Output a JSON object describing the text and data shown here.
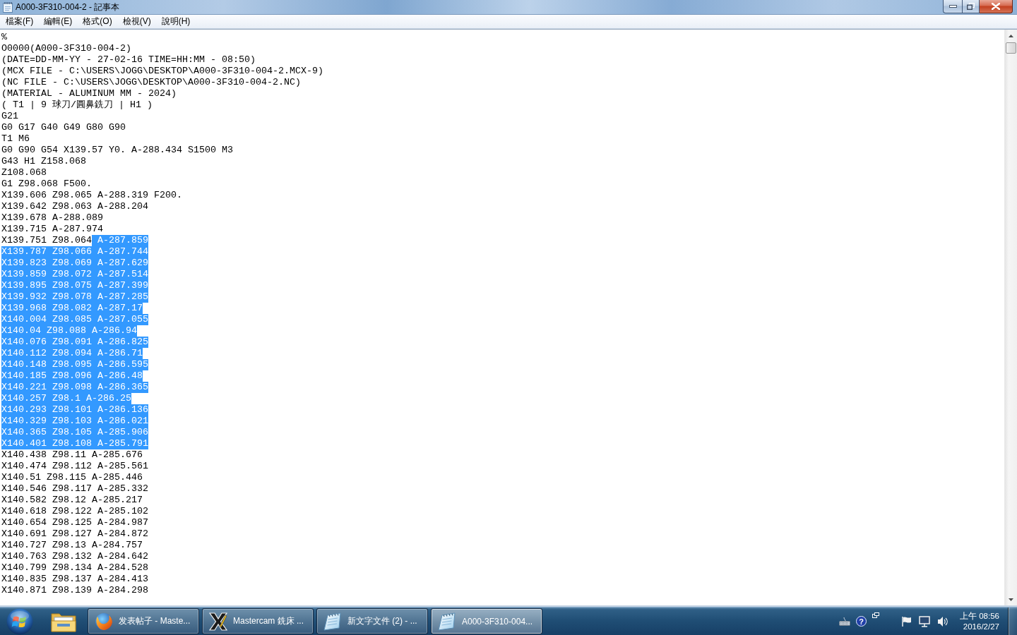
{
  "window": {
    "title": "A000-3F310-004-2 - 記事本"
  },
  "menu_bar": [
    "檔案(F)",
    "編輯(E)",
    "格式(O)",
    "檢視(V)",
    "說明(H)"
  ],
  "editor": {
    "lines": [
      {
        "segments": [
          {
            "text": "%",
            "selected": false
          }
        ]
      },
      {
        "segments": [
          {
            "text": "O0000(A000-3F310-004-2)",
            "selected": false
          }
        ]
      },
      {
        "segments": [
          {
            "text": "(DATE=DD-MM-YY - 27-02-16 TIME=HH:MM - 08:50)",
            "selected": false
          }
        ]
      },
      {
        "segments": [
          {
            "text": "(MCX FILE - C:\\USERS\\JOGG\\DESKTOP\\A000-3F310-004-2.MCX-9)",
            "selected": false
          }
        ]
      },
      {
        "segments": [
          {
            "text": "(NC FILE - C:\\USERS\\JOGG\\DESKTOP\\A000-3F310-004-2.NC)",
            "selected": false
          }
        ]
      },
      {
        "segments": [
          {
            "text": "(MATERIAL - ALUMINUM MM - 2024)",
            "selected": false
          }
        ]
      },
      {
        "segments": [
          {
            "text": "( T1 | 9 球刀/圓鼻銑刀 | H1 )",
            "selected": false
          }
        ]
      },
      {
        "segments": [
          {
            "text": "G21",
            "selected": false
          }
        ]
      },
      {
        "segments": [
          {
            "text": "G0 G17 G40 G49 G80 G90",
            "selected": false
          }
        ]
      },
      {
        "segments": [
          {
            "text": "T1 M6",
            "selected": false
          }
        ]
      },
      {
        "segments": [
          {
            "text": "G0 G90 G54 X139.57 Y0. A-288.434 S1500 M3",
            "selected": false
          }
        ]
      },
      {
        "segments": [
          {
            "text": "G43 H1 Z158.068",
            "selected": false
          }
        ]
      },
      {
        "segments": [
          {
            "text": "Z108.068",
            "selected": false
          }
        ]
      },
      {
        "segments": [
          {
            "text": "G1 Z98.068 F500.",
            "selected": false
          }
        ]
      },
      {
        "segments": [
          {
            "text": "X139.606 Z98.065 A-288.319 F200.",
            "selected": false
          }
        ]
      },
      {
        "segments": [
          {
            "text": "X139.642 Z98.063 A-288.204",
            "selected": false
          }
        ]
      },
      {
        "segments": [
          {
            "text": "X139.678 A-288.089",
            "selected": false
          }
        ]
      },
      {
        "segments": [
          {
            "text": "X139.715 A-287.974",
            "selected": false
          }
        ]
      },
      {
        "segments": [
          {
            "text": "X139.751 Z98.064",
            "selected": false
          },
          {
            "text": " A-287.859",
            "selected": true
          }
        ]
      },
      {
        "segments": [
          {
            "text": "X139.787 Z98.066 A-287.744",
            "selected": true
          }
        ]
      },
      {
        "segments": [
          {
            "text": "X139.823 Z98.069 A-287.629",
            "selected": true
          }
        ]
      },
      {
        "segments": [
          {
            "text": "X139.859 Z98.072 A-287.514",
            "selected": true
          }
        ]
      },
      {
        "segments": [
          {
            "text": "X139.895 Z98.075 A-287.399",
            "selected": true
          }
        ]
      },
      {
        "segments": [
          {
            "text": "X139.932 Z98.078 A-287.285",
            "selected": true
          }
        ]
      },
      {
        "segments": [
          {
            "text": "X139.968 Z98.082 A-287.17",
            "selected": true
          }
        ]
      },
      {
        "segments": [
          {
            "text": "X140.004 Z98.085 A-287.055",
            "selected": true
          }
        ]
      },
      {
        "segments": [
          {
            "text": "X140.04 Z98.088 A-286.94",
            "selected": true
          }
        ]
      },
      {
        "segments": [
          {
            "text": "X140.076 Z98.091 A-286.825",
            "selected": true
          }
        ]
      },
      {
        "segments": [
          {
            "text": "X140.112 Z98.094 A-286.71",
            "selected": true
          }
        ]
      },
      {
        "segments": [
          {
            "text": "X140.148 Z98.095 A-286.595",
            "selected": true
          }
        ]
      },
      {
        "segments": [
          {
            "text": "X140.185 Z98.096 A-286.48",
            "selected": true
          }
        ]
      },
      {
        "segments": [
          {
            "text": "X140.221 Z98.098 A-286.365",
            "selected": true
          }
        ]
      },
      {
        "segments": [
          {
            "text": "X140.257 Z98.1 A-286.25",
            "selected": true
          }
        ]
      },
      {
        "segments": [
          {
            "text": "X140.293 Z98.101 A-286.136",
            "selected": true
          }
        ]
      },
      {
        "segments": [
          {
            "text": "X140.329 Z98.103 A-286.021",
            "selected": true
          }
        ]
      },
      {
        "segments": [
          {
            "text": "X140.365 Z98.105 A-285.906",
            "selected": true
          }
        ]
      },
      {
        "segments": [
          {
            "text": "X140.401 Z98.108 A-285.791",
            "selected": true
          }
        ]
      },
      {
        "segments": [
          {
            "text": "X140.438 Z98.11 A-285.676",
            "selected": false
          }
        ]
      },
      {
        "segments": [
          {
            "text": "X140.474 Z98.112 A-285.561",
            "selected": false
          }
        ]
      },
      {
        "segments": [
          {
            "text": "X140.51 Z98.115 A-285.446",
            "selected": false
          }
        ]
      },
      {
        "segments": [
          {
            "text": "X140.546 Z98.117 A-285.332",
            "selected": false
          }
        ]
      },
      {
        "segments": [
          {
            "text": "X140.582 Z98.12 A-285.217",
            "selected": false
          }
        ]
      },
      {
        "segments": [
          {
            "text": "X140.618 Z98.122 A-285.102",
            "selected": false
          }
        ]
      },
      {
        "segments": [
          {
            "text": "X140.654 Z98.125 A-284.987",
            "selected": false
          }
        ]
      },
      {
        "segments": [
          {
            "text": "X140.691 Z98.127 A-284.872",
            "selected": false
          }
        ]
      },
      {
        "segments": [
          {
            "text": "X140.727 Z98.13 A-284.757",
            "selected": false
          }
        ]
      },
      {
        "segments": [
          {
            "text": "X140.763 Z98.132 A-284.642",
            "selected": false
          }
        ]
      },
      {
        "segments": [
          {
            "text": "X140.799 Z98.134 A-284.528",
            "selected": false
          }
        ]
      },
      {
        "segments": [
          {
            "text": "X140.835 Z98.137 A-284.413",
            "selected": false
          }
        ]
      },
      {
        "segments": [
          {
            "text": "X140.871 Z98.139 A-284.298",
            "selected": false
          }
        ]
      }
    ]
  },
  "taskbar": {
    "tasks": [
      {
        "kind": "browser",
        "label": "发表帖子 - Maste...",
        "selected": false
      },
      {
        "kind": "cam",
        "label": "Mastercam 銑床 ...",
        "selected": false
      },
      {
        "kind": "notepad",
        "label": "新文字文件 (2) - ...",
        "selected": false
      },
      {
        "kind": "notepad",
        "label": "A000-3F310-004...",
        "selected": true
      }
    ],
    "tray": {
      "help_icon": "?"
    },
    "clock": {
      "time": "上午 08:56",
      "date": "2016/2/27"
    }
  }
}
